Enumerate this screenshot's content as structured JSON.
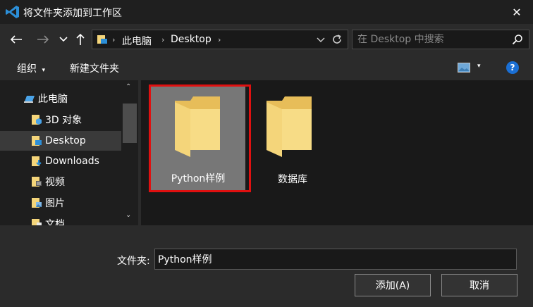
{
  "window": {
    "title": "将文件夹添加到工作区",
    "close_glyph": "✕"
  },
  "address_bar": {
    "segments": [
      "此电脑",
      "Desktop"
    ],
    "separator": "›",
    "search_placeholder": "在 Desktop 中搜索"
  },
  "toolbar": {
    "organize_label": "组织",
    "organize_caret": "▾",
    "new_folder_label": "新建文件夹",
    "view_caret": "▾",
    "help_label": "?"
  },
  "sidebar": {
    "items": [
      {
        "label": "此电脑",
        "icon": "computer-icon",
        "selected": false
      },
      {
        "label": "3D 对象",
        "icon": "3d-objects-icon",
        "selected": false
      },
      {
        "label": "Desktop",
        "icon": "desktop-folder-icon",
        "selected": true
      },
      {
        "label": "Downloads",
        "icon": "downloads-icon",
        "selected": false
      },
      {
        "label": "视频",
        "icon": "videos-icon",
        "selected": false
      },
      {
        "label": "图片",
        "icon": "pictures-icon",
        "selected": false
      },
      {
        "label": "文档",
        "icon": "documents-icon",
        "selected": false
      }
    ],
    "scroll_up": "⌃",
    "scroll_down": "⌄"
  },
  "files": [
    {
      "name": "Python样例",
      "selected": true
    },
    {
      "name": "数据库",
      "selected": false
    }
  ],
  "footer": {
    "folder_label": "文件夹:",
    "folder_value": "Python样例",
    "add_button": "添加(A)",
    "cancel_button": "取消"
  },
  "colors": {
    "highlight_border": "#e01010",
    "folder_yellow": "#f4d57a",
    "accent_blue": "#1a6fd4"
  }
}
